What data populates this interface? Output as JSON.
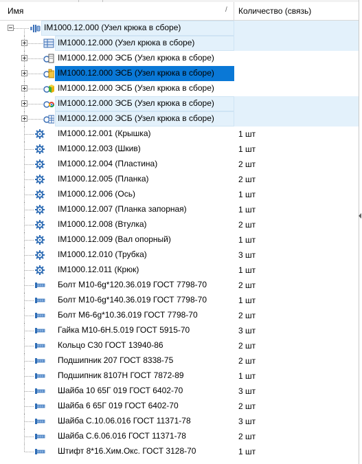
{
  "header": {
    "col_name": "Имя",
    "col_qty": "Количество (связь)",
    "sort_indicator": "/"
  },
  "colors": {
    "selection": "#0a78d6",
    "highlight": "#e3f1fb",
    "gear": "#2f6db5"
  },
  "rows": [
    {
      "label": "IM1000.12.000 (Узел крюка в сборе)",
      "qty": "",
      "icon": "assembly-root-icon",
      "state": "highlight"
    },
    {
      "label": "IM1000.12.000 (Узел крюка в сборе)",
      "qty": "",
      "icon": "table-icon",
      "state": "highlight"
    },
    {
      "label": "IM1000.12.000 ЭСБ (Узел крюка в сборе)",
      "qty": "",
      "icon": "drawing-document-icon",
      "state": "normal"
    },
    {
      "label": "IM1000.12.000 ЭСБ (Узел крюка в сборе)",
      "qty": "",
      "icon": "folder-document-icon",
      "state": "selected"
    },
    {
      "label": "IM1000.12.000 ЭСБ (Узел крюка в сборе)",
      "qty": "",
      "icon": "3d-model-icon",
      "state": "normal"
    },
    {
      "label": "IM1000.12.000 ЭСБ (Узел крюка в сборе)",
      "qty": "",
      "icon": "chrome-icon",
      "state": "highlight"
    },
    {
      "label": "IM1000.12.000 ЭСБ (Узел крюка в сборе)",
      "qty": "",
      "icon": "grid-document-icon",
      "state": "highlight"
    },
    {
      "label": "IM1000.12.001 (Крышка)",
      "qty": "1 шт",
      "icon": "gear-icon",
      "state": "normal"
    },
    {
      "label": "IM1000.12.003 (Шкив)",
      "qty": "1 шт",
      "icon": "gear-icon",
      "state": "normal"
    },
    {
      "label": "IM1000.12.004 (Пластина)",
      "qty": "2 шт",
      "icon": "gear-icon",
      "state": "normal"
    },
    {
      "label": "IM1000.12.005 (Планка)",
      "qty": "2 шт",
      "icon": "gear-icon",
      "state": "normal"
    },
    {
      "label": "IM1000.12.006 (Ось)",
      "qty": "1 шт",
      "icon": "gear-icon",
      "state": "normal"
    },
    {
      "label": "IM1000.12.007 (Планка запорная)",
      "qty": "1 шт",
      "icon": "gear-icon",
      "state": "normal"
    },
    {
      "label": "IM1000.12.008 (Втулка)",
      "qty": "2 шт",
      "icon": "gear-icon",
      "state": "normal"
    },
    {
      "label": "IM1000.12.009 (Вал опорный)",
      "qty": "1 шт",
      "icon": "gear-icon",
      "state": "normal"
    },
    {
      "label": "IM1000.12.010 (Трубка)",
      "qty": "3 шт",
      "icon": "gear-icon",
      "state": "normal"
    },
    {
      "label": "IM1000.12.011 (Крюк)",
      "qty": "1 шт",
      "icon": "gear-icon",
      "state": "normal"
    },
    {
      "label": "Болт M10-6g*120.36.019 ГОСТ 7798-70",
      "qty": "2 шт",
      "icon": "standard-part-icon",
      "state": "normal"
    },
    {
      "label": "Болт M10-6g*140.36.019 ГОСТ 7798-70",
      "qty": "1 шт",
      "icon": "standard-part-icon",
      "state": "normal"
    },
    {
      "label": "Болт M6-6g*10.36.019 ГОСТ 7798-70",
      "qty": "2 шт",
      "icon": "standard-part-icon",
      "state": "normal"
    },
    {
      "label": "Гайка M10-6H.5.019 ГОСТ 5915-70",
      "qty": "3 шт",
      "icon": "standard-part-icon",
      "state": "normal"
    },
    {
      "label": "Кольцо C30 ГОСТ 13940-86",
      "qty": "2 шт",
      "icon": "standard-part-icon",
      "state": "normal"
    },
    {
      "label": "Подшипник 207 ГОСТ 8338-75",
      "qty": "2 шт",
      "icon": "standard-part-icon",
      "state": "normal"
    },
    {
      "label": "Подшипник 8107H ГОСТ 7872-89",
      "qty": "1 шт",
      "icon": "standard-part-icon",
      "state": "normal"
    },
    {
      "label": "Шайба 10 65Г 019 ГОСТ 6402-70",
      "qty": "3 шт",
      "icon": "standard-part-icon",
      "state": "normal"
    },
    {
      "label": "Шайба 6 65Г 019 ГОСТ 6402-70",
      "qty": "2 шт",
      "icon": "standard-part-icon",
      "state": "normal"
    },
    {
      "label": "Шайба C.10.06.016 ГОСТ 11371-78",
      "qty": "3 шт",
      "icon": "standard-part-icon",
      "state": "normal"
    },
    {
      "label": "Шайба C.6.06.016 ГОСТ 11371-78",
      "qty": "2 шт",
      "icon": "standard-part-icon",
      "state": "normal"
    },
    {
      "label": "Штифт 8*16.Хим.Окс. ГОСТ 3128-70",
      "qty": "1 шт",
      "icon": "standard-part-icon",
      "state": "normal"
    }
  ]
}
